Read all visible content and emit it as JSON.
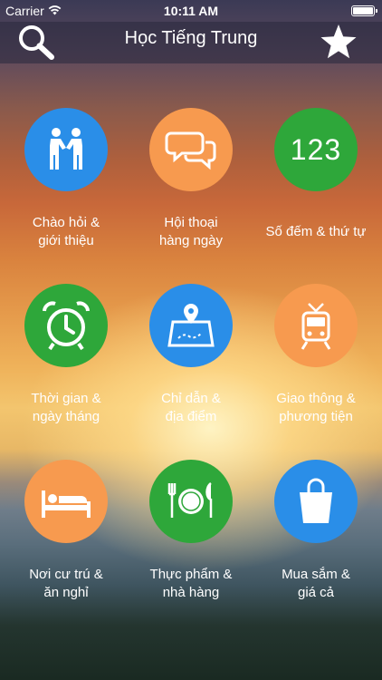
{
  "status_bar": {
    "carrier": "Carrier",
    "time": "10:11 AM"
  },
  "navbar": {
    "title": "Học Tiếng Trung"
  },
  "grid": [
    {
      "label": "Chào hỏi &\ngiới thiệu",
      "color": "#2a8ee8",
      "icon": "handshake-icon"
    },
    {
      "label": "Hội thoại\nhàng ngày",
      "color": "#f79a4f",
      "icon": "chat-bubbles-icon"
    },
    {
      "label": "Số đếm & thứ tự",
      "color": "#2ea73a",
      "icon": "numbers-123-icon",
      "icon_text": "123"
    },
    {
      "label": "Thời gian &\nngày tháng",
      "color": "#2ea73a",
      "icon": "alarm-clock-icon"
    },
    {
      "label": "Chỉ dẫn &\nđịa điểm",
      "color": "#2a8ee8",
      "icon": "map-pin-icon"
    },
    {
      "label": "Giao thông &\nphương tiện",
      "color": "#f79a4f",
      "icon": "tram-icon"
    },
    {
      "label": "Nơi cư trú &\năn nghỉ",
      "color": "#f79a4f",
      "icon": "bed-icon"
    },
    {
      "label": "Thực phẩm &\nnhà hàng",
      "color": "#2ea73a",
      "icon": "plate-cutlery-icon"
    },
    {
      "label": "Mua sắm &\ngiá cả",
      "color": "#2a8ee8",
      "icon": "shopping-bag-icon"
    }
  ]
}
